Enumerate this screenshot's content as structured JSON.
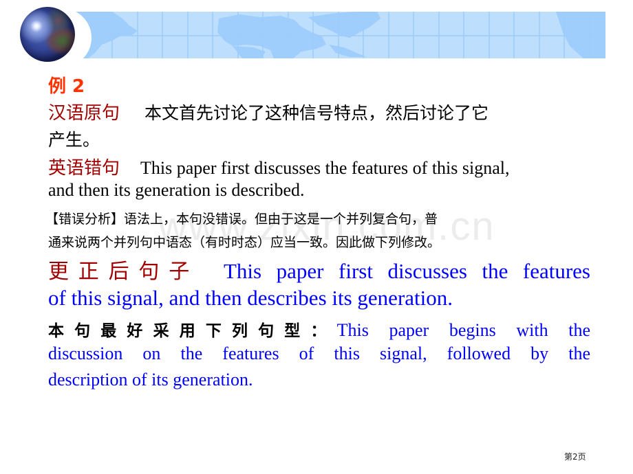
{
  "slide": {
    "example_title": "例 2",
    "chinese_original": {
      "label": "汉语原句",
      "text_line1": "本文首先讨论了这种信号特点，然后讨论了它",
      "text_line2": "产生。"
    },
    "english_wrong": {
      "label": "英语错句",
      "text_line1": "This paper first discusses the features of this signal,",
      "text_line2": "and then its generation is described."
    },
    "error_analysis": {
      "line1": "【错误分析】语法上，本句没错误。但由于这是一个并列复合句，普",
      "line2": "通来说两个并列句中语态（有时时态）应当一致。因此做下列修改。"
    },
    "corrected": {
      "label": "更正后句子",
      "text_line1": "This paper first discusses the features",
      "text_line2": "of this signal, and then describes its generation."
    },
    "better_pattern": {
      "label": "本句最好采用下列句型：",
      "text_line1": "This paper begins with the",
      "text_line2": "discussion on the features of this signal, followed by the",
      "text_line3": "description of its generation."
    }
  },
  "watermark": "www.zixin.com.cn",
  "footer": {
    "page_label": "第2页"
  },
  "colors": {
    "example_title": "#FF3300",
    "label": "#A00000",
    "english_corrected": "#0000FF",
    "banner_bg": "#BEDEFE",
    "banner_grid": "#9DCBFB"
  }
}
